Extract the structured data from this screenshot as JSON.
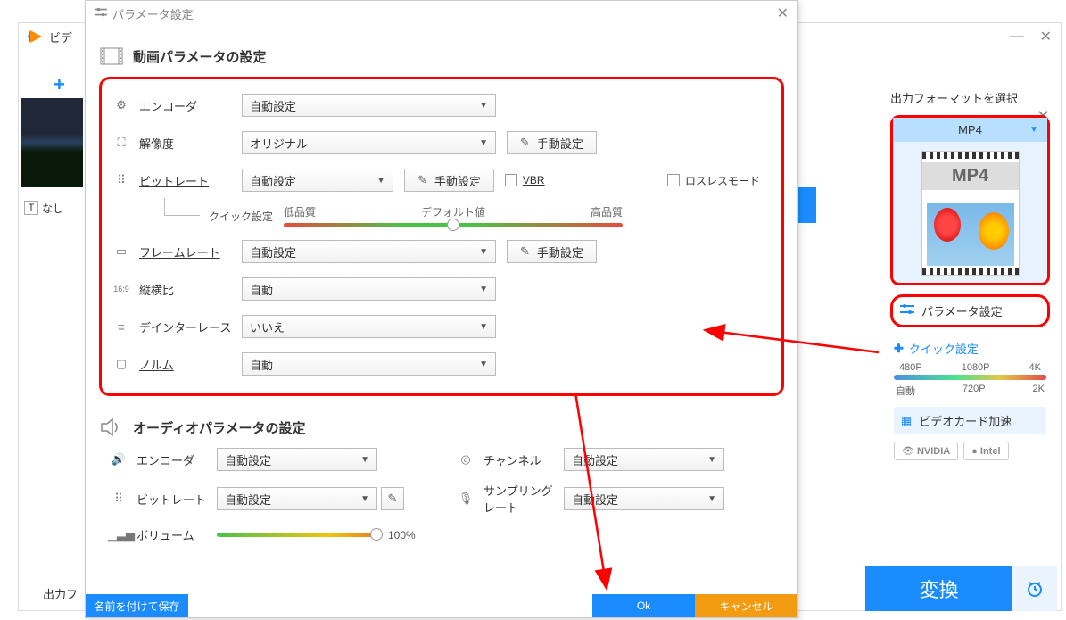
{
  "main_window": {
    "title": "ビデ",
    "minimize": "—",
    "close": "✕",
    "add": "+",
    "thumb_label_prefix": "T",
    "thumb_label": "なし",
    "bottom_label": "出力フ"
  },
  "right_panel": {
    "close": "✕",
    "heading": "出力フォーマットを選択",
    "format_name": "MP4",
    "format_badge": "MP4",
    "param_button": "パラメータ設定",
    "quick_title": "クイック設定",
    "res_top": [
      "480P",
      "1080P",
      "4K"
    ],
    "res_bottom": [
      "自動",
      "720P",
      "2K"
    ],
    "gpu_accel": "ビデオカード加速",
    "gpu_nvidia": "NVIDIA",
    "gpu_intel": "Intel"
  },
  "convert": {
    "button": "変換",
    "clock": "⏰"
  },
  "dialog": {
    "title": "パラメータ設定",
    "close": "✕",
    "video_section": "動画パラメータの設定",
    "audio_section": "オーディオパラメータの設定",
    "rows": {
      "encoder": {
        "label": "エンコーダ",
        "value": "自動設定"
      },
      "resolution": {
        "label": "解像度",
        "value": "オリジナル",
        "manual": "手動設定"
      },
      "bitrate": {
        "label": "ビットレート",
        "value": "自動設定",
        "manual": "手動設定",
        "vbr": "VBR",
        "lossless": "ロスレスモード"
      },
      "quick": {
        "label": "クイック設定",
        "low": "低品質",
        "default": "デフォルト値",
        "high": "高品質"
      },
      "framerate": {
        "label": "フレームレート",
        "value": "自動設定",
        "manual": "手動設定"
      },
      "aspect": {
        "label": "縦横比",
        "value": "自動"
      },
      "deinterlace": {
        "label": "デインターレース",
        "value": "いいえ"
      },
      "norm": {
        "label": "ノルム",
        "value": "自動"
      }
    },
    "audio": {
      "encoder": {
        "label": "エンコーダ",
        "value": "自動設定"
      },
      "channel": {
        "label": "チャンネル",
        "value": "自動設定"
      },
      "bitrate": {
        "label": "ビットレート",
        "value": "自動設定"
      },
      "samplerate": {
        "label": "サンプリングレート",
        "value": "自動設定"
      },
      "volume": {
        "label": "ボリューム",
        "value": "100%"
      }
    },
    "footer": {
      "save_as": "名前を付けて保存",
      "ok": "Ok",
      "cancel": "キャンセル"
    }
  }
}
